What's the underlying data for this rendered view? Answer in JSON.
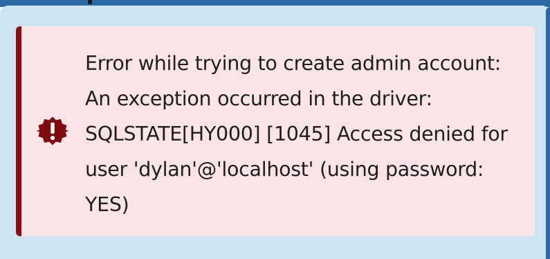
{
  "alert": {
    "severity": "error",
    "icon": "exclamation-badge-icon",
    "accent_color": "#8b0e12",
    "background_color": "#fbe4e6",
    "lines": [
      "Error while trying to create admin account:",
      "An exception occurred in the driver:",
      "SQLSTATE[HY000] [1045] Access denied for",
      "user 'dylan'@'localhost' (using password:",
      "YES)"
    ]
  }
}
